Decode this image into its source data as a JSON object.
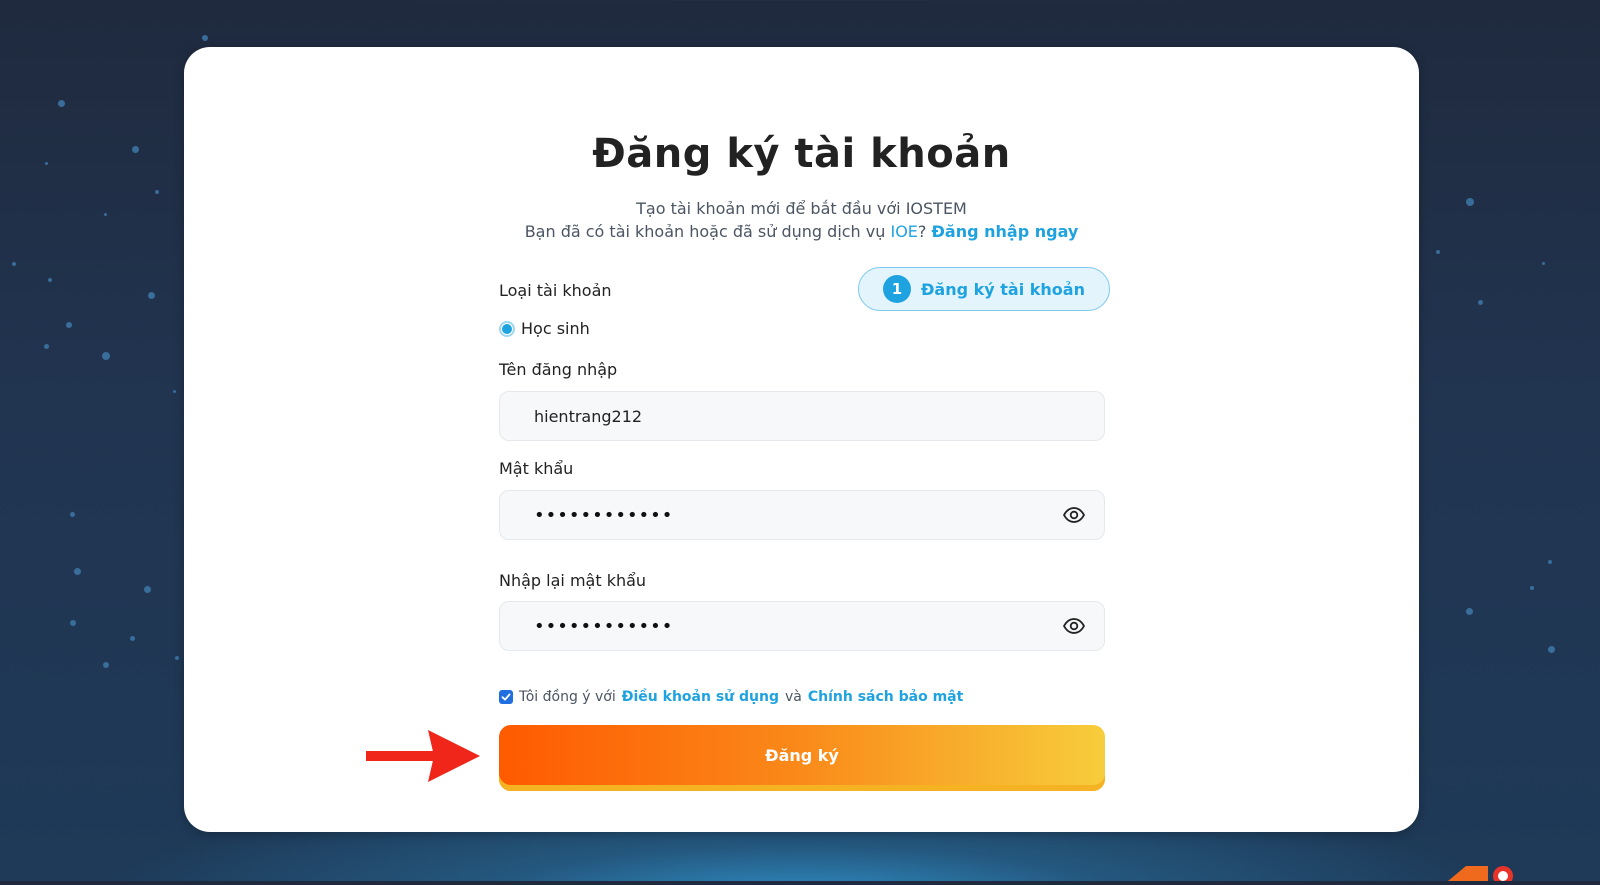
{
  "page": {
    "title": "Đăng ký tài khoản",
    "subtitle_line1": "Tạo tài khoản mới để bắt đầu với IOSTEM",
    "subtitle_line2_prefix": "Bạn đã có tài khoản hoặc đã sử dụng dịch vụ",
    "subtitle_ioe_link": "IOE",
    "subtitle_question_mark": "?",
    "login_link": "Đăng nhập ngay"
  },
  "step": {
    "number": "1",
    "label": "Đăng ký tài khoản"
  },
  "form": {
    "account_type_label": "Loại tài khoản",
    "account_type_option": "Học sinh",
    "username_label": "Tên đăng nhập",
    "username_value": "hientrang212",
    "password_label": "Mật khẩu",
    "password_value": "••••••••••••",
    "confirm_password_label": "Nhập lại mật khẩu",
    "confirm_password_value": "••••••••••••",
    "terms_prefix": "Tôi đồng ý với",
    "terms_link": "Điều khoản sử dụng",
    "terms_and": "và",
    "privacy_link": "Chính sách bảo mật",
    "terms_checked": true,
    "submit_label": "Đăng ký"
  },
  "colors": {
    "accent": "#1fa3e0",
    "background_dark": "#1f2a3e",
    "button_gradient_start": "#ff5a00",
    "button_gradient_end": "#f7cd3c",
    "annotation_arrow": "#f0261b"
  },
  "icons": {
    "password_toggle": "eye-icon",
    "confirm_password_toggle": "eye-icon",
    "annotation": "red-arrow-icon"
  }
}
